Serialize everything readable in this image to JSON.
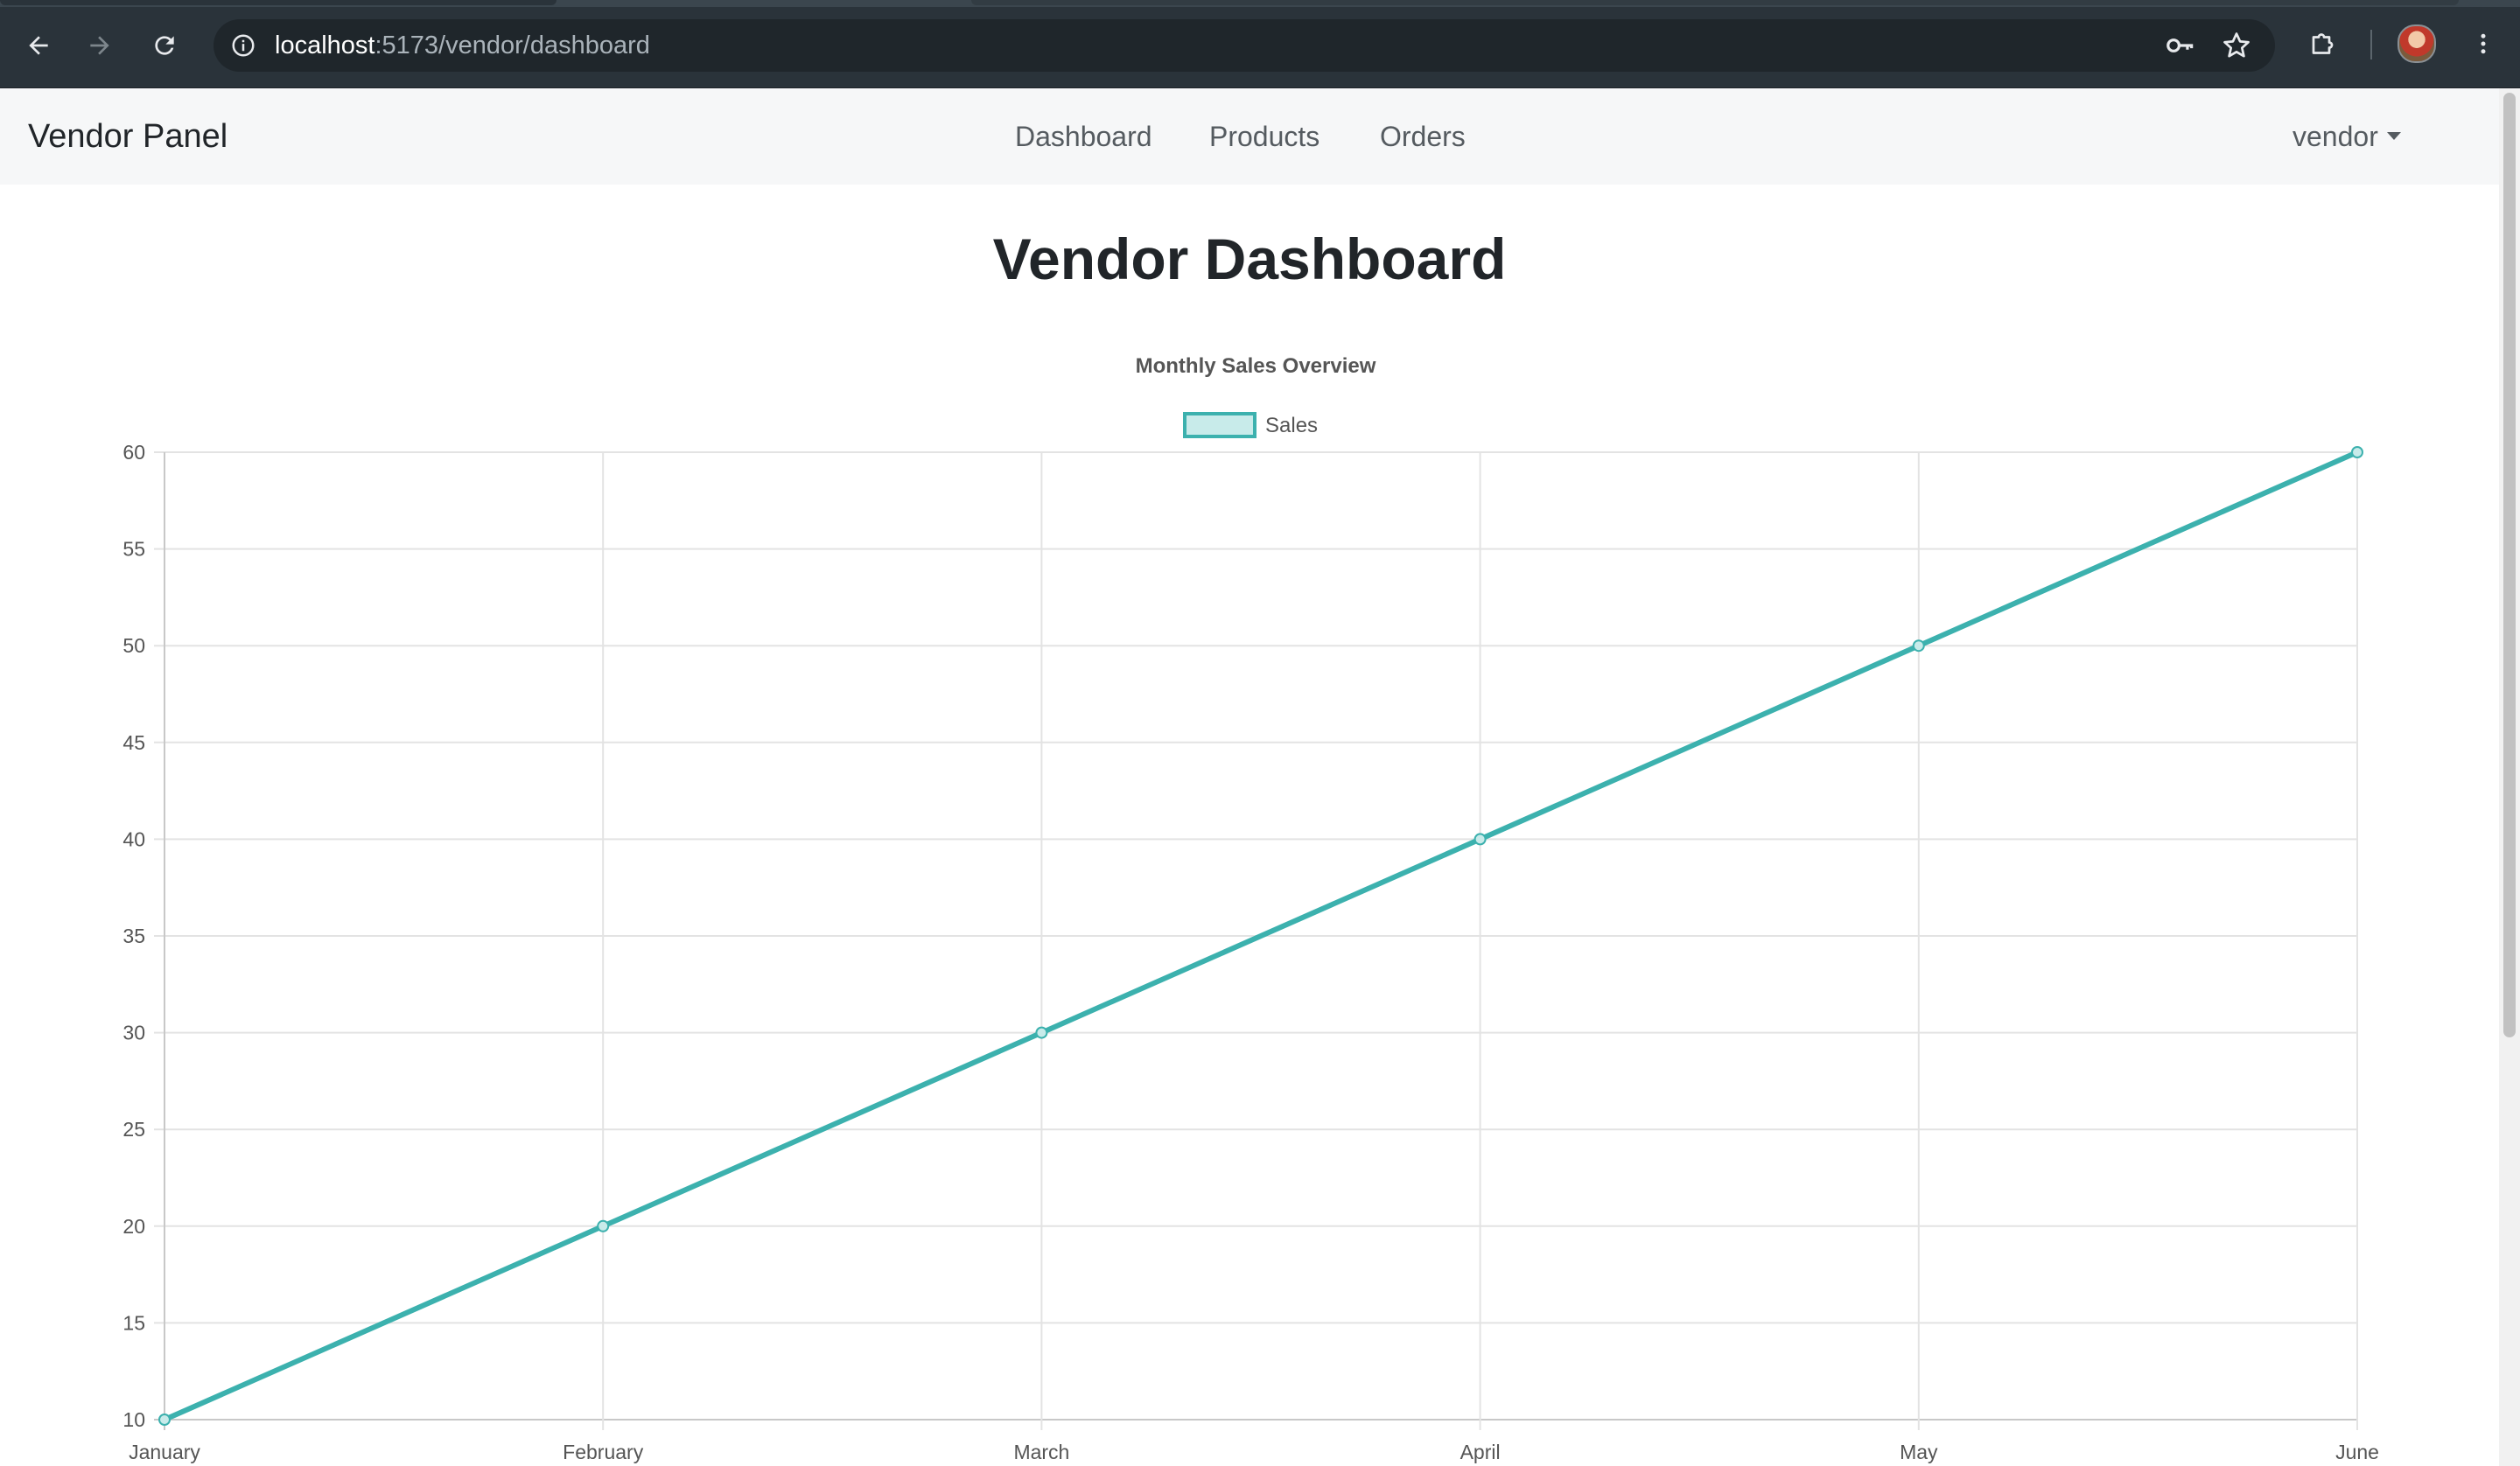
{
  "browser": {
    "url_host": "localhost",
    "url_path": ":5173/vendor/dashboard"
  },
  "navbar": {
    "brand": "Vendor Panel",
    "links": [
      "Dashboard",
      "Products",
      "Orders"
    ],
    "user": "vendor"
  },
  "page": {
    "title": "Vendor Dashboard"
  },
  "chart_data": {
    "type": "line",
    "title": "Monthly Sales Overview",
    "categories": [
      "January",
      "February",
      "March",
      "April",
      "May",
      "June"
    ],
    "series": [
      {
        "name": "Sales",
        "values": [
          10,
          20,
          30,
          40,
          50,
          60
        ],
        "color": "#3cb1ae",
        "fill": "#c8ebea"
      }
    ],
    "ylim": [
      10,
      60
    ],
    "yticks": [
      10,
      15,
      20,
      25,
      30,
      35,
      40,
      45,
      50,
      55,
      60
    ],
    "grid": true,
    "legend": "top-center"
  }
}
